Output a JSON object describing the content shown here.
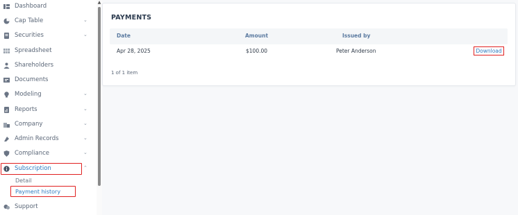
{
  "sidebar": {
    "items": [
      {
        "label": "Dashboard",
        "icon": "dashboard-icon",
        "chevron": ""
      },
      {
        "label": "Cap Table",
        "icon": "pie-chart-icon",
        "chevron": "⌄"
      },
      {
        "label": "Securities",
        "icon": "certificate-icon",
        "chevron": "⌄"
      },
      {
        "label": "Spreadsheet",
        "icon": "spreadsheet-icon",
        "chevron": ""
      },
      {
        "label": "Shareholders",
        "icon": "user-icon",
        "chevron": ""
      },
      {
        "label": "Documents",
        "icon": "documents-icon",
        "chevron": ""
      },
      {
        "label": "Modeling",
        "icon": "lightbulb-icon",
        "chevron": "⌄"
      },
      {
        "label": "Reports",
        "icon": "report-icon",
        "chevron": "⌄"
      },
      {
        "label": "Company",
        "icon": "building-icon",
        "chevron": "⌄"
      },
      {
        "label": "Admin Records",
        "icon": "records-icon",
        "chevron": "⌄"
      },
      {
        "label": "Compliance",
        "icon": "shield-icon",
        "chevron": "⌄"
      },
      {
        "label": "Subscription",
        "icon": "info-icon",
        "chevron": "⌃"
      },
      {
        "label": "Support",
        "icon": "support-icon",
        "chevron": ""
      }
    ],
    "subscription_sub": {
      "detail": "Detail",
      "payment_history": "Payment history"
    }
  },
  "payments": {
    "title": "PAYMENTS",
    "columns": {
      "date": "Date",
      "amount": "Amount",
      "issued_by": "Issued by"
    },
    "rows": [
      {
        "date": "Apr 28, 2025",
        "amount": "$100.00",
        "issued_by": "Peter Anderson",
        "action": "Download"
      }
    ],
    "pager": "1 of 1 item"
  },
  "colors": {
    "highlight": "#e02020",
    "link": "#2f7bc0",
    "header_text": "#5b7aa0"
  }
}
